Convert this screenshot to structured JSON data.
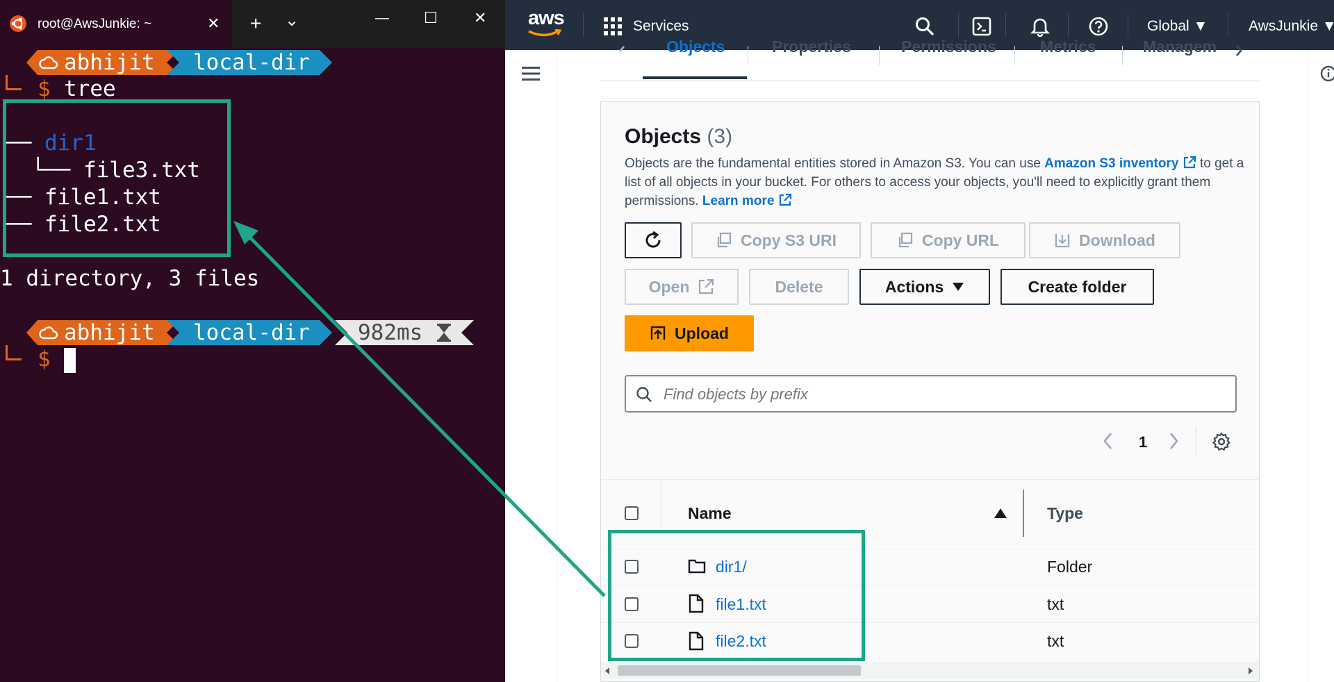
{
  "terminal": {
    "tab_title": "root@AwsJunkie: ~",
    "titlebar_glyphs": {
      "close": "✕",
      "new_tab": "+",
      "dropdown": "⌄",
      "minimize": "—",
      "maximize": "☐",
      "window_close": "✕"
    },
    "prompt_user": "abhijit",
    "prompt_dir": "local-dir",
    "prompt_symbol": "$",
    "command": "tree",
    "tree_lines": [
      {
        "prefix": "── ",
        "name": "dir1",
        "kind": "directory"
      },
      {
        "prefix": "  └── ",
        "name": "file3.txt",
        "kind": "file"
      },
      {
        "prefix": "── ",
        "name": "file1.txt",
        "kind": "file"
      },
      {
        "prefix": "── ",
        "name": "file2.txt",
        "kind": "file"
      }
    ],
    "summary": "1 directory, 3 files",
    "duration": "982ms",
    "colors": {
      "background": "#2c0a22",
      "user_segment": "#e0651a",
      "dir_segment": "#1a8fc1",
      "duration_segment": "#e8e8e8",
      "directory_text": "#2a63c8",
      "highlight": "#1fa589"
    }
  },
  "aws": {
    "nav": {
      "logo": "aws",
      "services": "Services",
      "region": "Global ▼",
      "account": "AwsJunkie ▼"
    },
    "tabs": [
      "Objects",
      "Properties",
      "Permissions",
      "Metrics",
      "Managem"
    ],
    "objects": {
      "title": "Objects",
      "count": "(3)",
      "desc_1": "Objects are the fundamental entities stored in Amazon S3. You can use ",
      "link_inventory": "Amazon S3 inventory",
      "desc_2": " to get a list of all objects in your bucket. For others to access your objects, you'll need to explicitly grant them permissions. ",
      "link_learn": "Learn more"
    },
    "buttons": {
      "copy_s3_uri": "Copy S3 URI",
      "copy_url": "Copy URL",
      "download": "Download",
      "open": "Open",
      "delete": "Delete",
      "actions": "Actions",
      "create_folder": "Create folder",
      "upload": "Upload"
    },
    "search": {
      "placeholder": "Find objects by prefix"
    },
    "pagination": {
      "current_page": "1"
    },
    "table": {
      "headers": {
        "name": "Name",
        "type": "Type"
      },
      "rows": [
        {
          "name": "dir1/",
          "type": "Folder",
          "icon": "folder-icon"
        },
        {
          "name": "file1.txt",
          "type": "txt",
          "icon": "file-icon"
        },
        {
          "name": "file2.txt",
          "type": "txt",
          "icon": "file-icon"
        }
      ]
    },
    "colors": {
      "nav": "#232f3e",
      "upload": "#ff9900",
      "link": "#0972d3"
    }
  }
}
